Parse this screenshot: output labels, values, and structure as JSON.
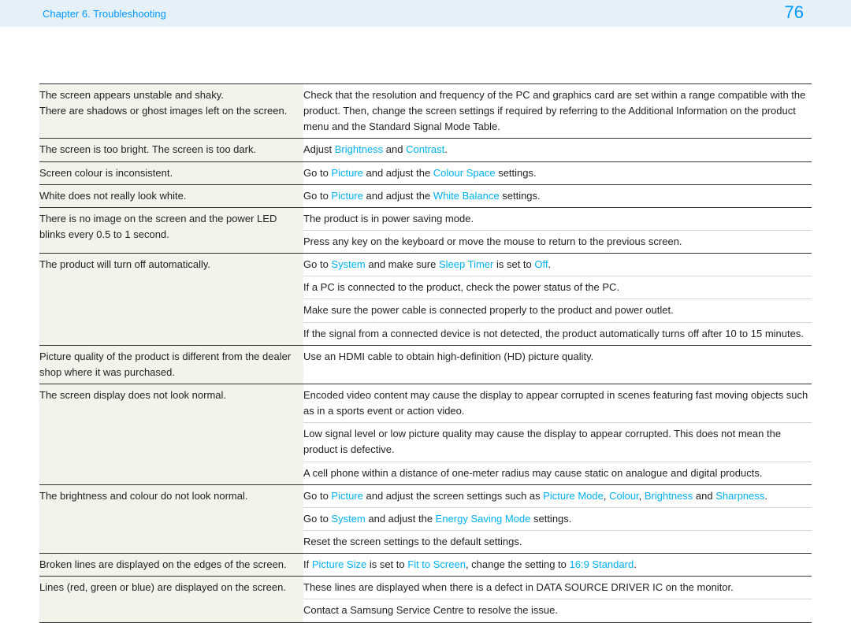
{
  "header": {
    "chapter": "Chapter 6. Troubleshooting",
    "page_number": "76"
  },
  "rows": [
    {
      "symptom": [
        "The screen appears unstable and shaky.",
        "There are shadows or ghost images left on the screen."
      ],
      "solutions": [
        [
          {
            "t": "Check that the resolution and frequency of the PC and graphics card are set within a range compatible with the product. Then, change the screen settings if required by referring to the Additional Information on the product menu and the Standard Signal Mode Table."
          }
        ]
      ]
    },
    {
      "symptom": [
        "The screen is too bright. The screen is too dark."
      ],
      "solutions": [
        [
          {
            "t": "Adjust "
          },
          {
            "t": "Brightness",
            "hl": true
          },
          {
            "t": " and "
          },
          {
            "t": "Contrast",
            "hl": true
          },
          {
            "t": "."
          }
        ]
      ]
    },
    {
      "symptom": [
        "Screen colour is inconsistent."
      ],
      "solutions": [
        [
          {
            "t": "Go to "
          },
          {
            "t": "Picture",
            "hl": true
          },
          {
            "t": " and adjust the "
          },
          {
            "t": "Colour Space",
            "hl": true
          },
          {
            "t": " settings."
          }
        ]
      ]
    },
    {
      "symptom": [
        "White does not really look white."
      ],
      "solutions": [
        [
          {
            "t": "Go to "
          },
          {
            "t": "Picture",
            "hl": true
          },
          {
            "t": " and adjust the "
          },
          {
            "t": "White Balance",
            "hl": true
          },
          {
            "t": " settings."
          }
        ]
      ]
    },
    {
      "symptom": [
        "There is no image on the screen and the power LED blinks every 0.5 to 1 second."
      ],
      "solutions": [
        [
          {
            "t": "The product is in power saving mode."
          }
        ],
        [
          {
            "t": "Press any key on the keyboard or move the mouse to return to the previous screen."
          }
        ]
      ]
    },
    {
      "symptom": [
        "The product will turn off automatically."
      ],
      "solutions": [
        [
          {
            "t": "Go to "
          },
          {
            "t": "System",
            "hl": true
          },
          {
            "t": " and make sure "
          },
          {
            "t": "Sleep Timer",
            "hl": true
          },
          {
            "t": " is set to "
          },
          {
            "t": "Off",
            "hl": true
          },
          {
            "t": "."
          }
        ],
        [
          {
            "t": "If a PC is connected to the product, check the power status of the PC."
          }
        ],
        [
          {
            "t": "Make sure the power cable is connected properly to the product and power outlet."
          }
        ],
        [
          {
            "t": "If the signal from a connected device is not detected, the product automatically turns off after 10 to 15 minutes."
          }
        ]
      ]
    },
    {
      "symptom": [
        "Picture quality of the product is different from the dealer shop where it was purchased."
      ],
      "solutions": [
        [
          {
            "t": "Use an HDMI cable to obtain high-definition (HD) picture quality."
          }
        ]
      ]
    },
    {
      "symptom": [
        "The screen display does not look normal."
      ],
      "solutions": [
        [
          {
            "t": "Encoded video content may cause the display to appear corrupted in scenes featuring fast moving objects such as in a sports event or action video."
          }
        ],
        [
          {
            "t": "Low signal level or low picture quality may cause the display to appear corrupted. This does not mean the product is defective."
          }
        ],
        [
          {
            "t": "A cell phone within a distance of one-meter radius may cause static on analogue and digital products."
          }
        ]
      ]
    },
    {
      "symptom": [
        "The brightness and colour do not look normal."
      ],
      "solutions": [
        [
          {
            "t": "Go to "
          },
          {
            "t": "Picture",
            "hl": true
          },
          {
            "t": " and adjust the screen settings such as "
          },
          {
            "t": "Picture Mode",
            "hl": true
          },
          {
            "t": ", "
          },
          {
            "t": "Colour",
            "hl": true
          },
          {
            "t": ", "
          },
          {
            "t": "Brightness",
            "hl": true
          },
          {
            "t": " and "
          },
          {
            "t": "Sharpness",
            "hl": true
          },
          {
            "t": "."
          }
        ],
        [
          {
            "t": "Go to "
          },
          {
            "t": "System",
            "hl": true
          },
          {
            "t": " and adjust the "
          },
          {
            "t": "Energy Saving Mode",
            "hl": true
          },
          {
            "t": " settings."
          }
        ],
        [
          {
            "t": "Reset the screen settings to the default settings."
          }
        ]
      ]
    },
    {
      "symptom": [
        "Broken lines are displayed on the edges of the screen."
      ],
      "solutions": [
        [
          {
            "t": "If "
          },
          {
            "t": "Picture Size",
            "hl": true
          },
          {
            "t": " is set to "
          },
          {
            "t": "Fit to Screen",
            "hl": true
          },
          {
            "t": ", change the setting to "
          },
          {
            "t": "16:9 Standard",
            "hl": true
          },
          {
            "t": "."
          }
        ]
      ]
    },
    {
      "symptom": [
        "Lines (red, green or blue) are displayed on the screen."
      ],
      "solutions": [
        [
          {
            "t": "These lines are displayed when there is a defect in DATA SOURCE DRIVER IC on the monitor."
          }
        ],
        [
          {
            "t": "Contact a Samsung Service Centre to resolve the issue."
          }
        ]
      ]
    }
  ]
}
